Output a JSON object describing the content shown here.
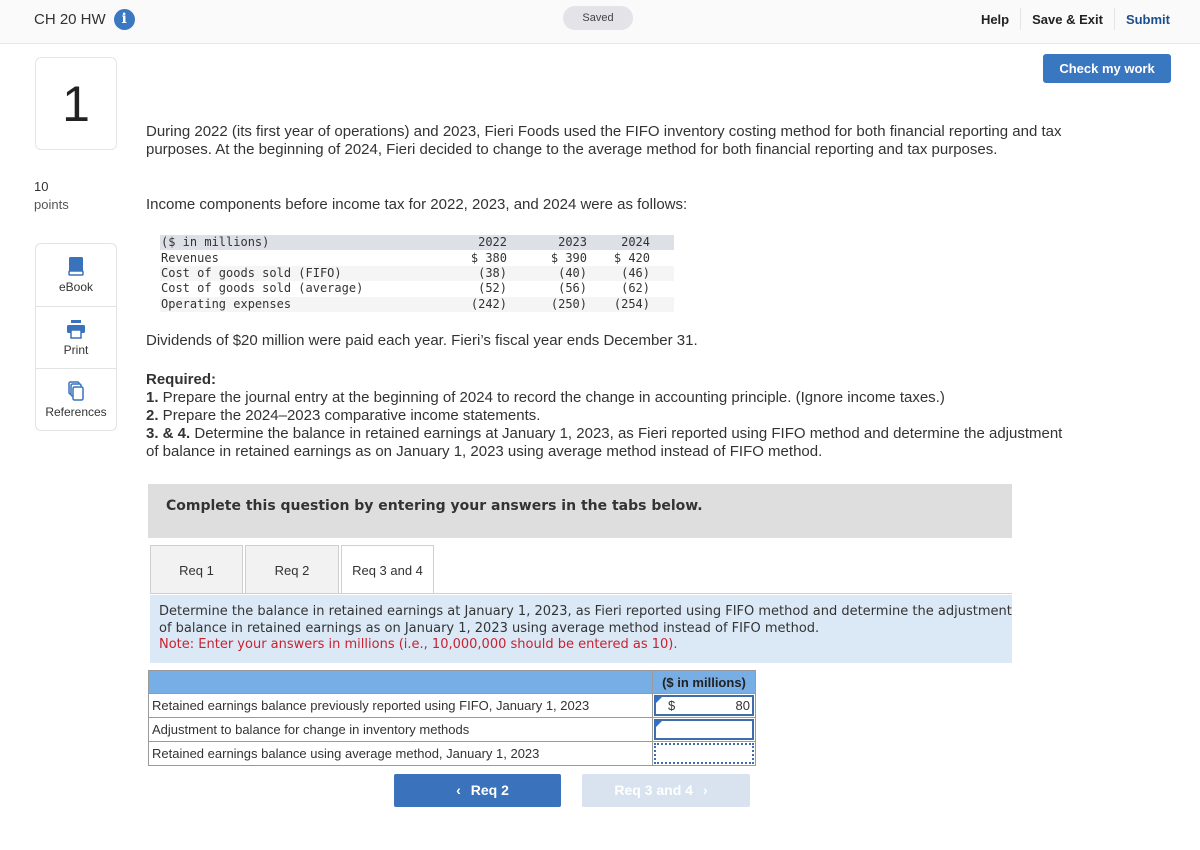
{
  "header": {
    "assignment_title": "CH 20 HW",
    "info_icon": "info-icon",
    "saved_status": "Saved",
    "links": {
      "help": "Help",
      "save_exit": "Save & Exit",
      "submit": "Submit"
    },
    "check_my_work": "Check my work"
  },
  "left_rail": {
    "question_number": "1",
    "points_value": "10",
    "points_label": "points",
    "tools": [
      {
        "label": "eBook",
        "icon": "book-icon"
      },
      {
        "label": "Print",
        "icon": "printer-icon"
      },
      {
        "label": "References",
        "icon": "copy-pages-icon"
      }
    ]
  },
  "question": {
    "intro": "During 2022 (its first year of operations) and 2023, Fieri Foods used the FIFO inventory costing method for both financial reporting and tax purposes. At the beginning of 2024, Fieri decided to change to the average method for both financial reporting and tax purposes.",
    "components_intro": "Income components before income tax for 2022, 2023, and 2024 were as follows:",
    "data_table": {
      "header": [
        "($ in millions)",
        "2022",
        "2023",
        "2024"
      ],
      "rows": [
        [
          "Revenues",
          "$ 380",
          "$ 390",
          "$ 420"
        ],
        [
          "Cost of goods sold (FIFO)",
          "(38)",
          "(40)",
          "(46)"
        ],
        [
          "Cost of goods sold (average)",
          "(52)",
          "(56)",
          "(62)"
        ],
        [
          "Operating expenses",
          "(242)",
          "(250)",
          "(254)"
        ]
      ]
    },
    "dividends_text": "Dividends of $20 million were paid each year. Fieri’s fiscal year ends December 31.",
    "required_label": "Required:",
    "requirements": [
      {
        "num": "1.",
        "text": " Prepare the journal entry at the beginning of 2024 to record the change in accounting principle. (Ignore income taxes.)"
      },
      {
        "num": "2.",
        "text": " Prepare the 2024–2023 comparative income statements."
      },
      {
        "num": "3. & 4.",
        "text": " Determine the balance in retained earnings at January 1, 2023, as Fieri reported using FIFO method and determine the adjustment of balance in retained earnings as on January 1, 2023 using average method instead of FIFO method."
      }
    ]
  },
  "tabs_section": {
    "banner": "Complete this question by entering your answers in the tabs below.",
    "tabs": [
      {
        "label": "Req 1",
        "active": false
      },
      {
        "label": "Req 2",
        "active": false
      },
      {
        "label": "Req 3 and 4",
        "active": true
      }
    ],
    "instructions": "Determine the balance in retained earnings at January 1, 2023, as Fieri reported using FIFO method and determine the adjustment of balance in retained earnings as on January 1, 2023 using average method instead of FIFO method.",
    "note": "Note: Enter your answers in millions (i.e., 10,000,000 should be entered as 10).",
    "answer_table": {
      "column_header": "($ in millions)",
      "rows": [
        {
          "label": "Retained earnings balance previously reported using FIFO, January 1, 2023",
          "currency": "$",
          "value": "80"
        },
        {
          "label": "Adjustment to balance for change in inventory methods",
          "currency": "",
          "value": ""
        },
        {
          "label": "Retained earnings balance using average method, January 1, 2023",
          "currency": "",
          "value": ""
        }
      ]
    },
    "nav": {
      "prev_label": "Req 2",
      "next_label": "Req 3 and 4"
    }
  }
}
